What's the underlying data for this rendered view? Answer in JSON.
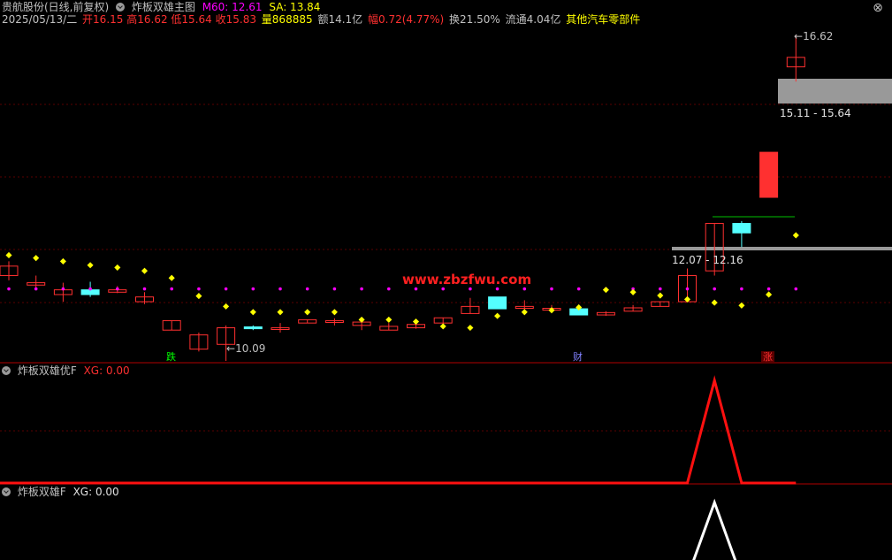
{
  "header": {
    "stock_name": "贵航股份(日线,前复权)",
    "indicator_name": "炸板双雄主图",
    "m60_label": "M60: 12.61",
    "sa_label": "SA: 13.84",
    "date": "2025/05/13/二",
    "open": "开16.15",
    "high": "高16.62",
    "low": "低15.64",
    "close": "收15.83",
    "volume": "量868885",
    "amount": "额14.1亿",
    "change": "幅0.72(4.77%)",
    "turnover": "换21.50%",
    "float": "流通4.04亿",
    "sector": "其他汽车零部件",
    "close_icon": "close-icon",
    "colors": {
      "up": "#ff3030",
      "down": "#54ffff",
      "yellow": "#ffff00",
      "magenta": "#ff00ff"
    }
  },
  "annotations": {
    "high_price": "16.62",
    "low_price": "10.09",
    "range_top": "15.11 - 15.64",
    "range_bottom": "12.07 - 12.16",
    "tag_die": "跌",
    "tag_cai": "财",
    "tag_zhang": "涨"
  },
  "watermark": "www.zbzfwu.com",
  "panel2": {
    "title": "炸板双雄优F",
    "xg": "XG: 0.00"
  },
  "panel3": {
    "title": "炸板双雄F",
    "xg": "XG: 0.00"
  },
  "chart_data": {
    "type": "candlestick",
    "candles": [
      {
        "o": 11.55,
        "c": 11.75,
        "h": 11.85,
        "l": 11.45
      },
      {
        "o": 11.35,
        "c": 11.4,
        "h": 11.55,
        "l": 11.3
      },
      {
        "o": 11.15,
        "c": 11.25,
        "h": 11.4,
        "l": 11.0
      },
      {
        "o": 11.25,
        "c": 11.15,
        "h": 11.42,
        "l": 11.1
      },
      {
        "o": 11.2,
        "c": 11.25,
        "h": 11.33,
        "l": 11.18
      },
      {
        "o": 11.0,
        "c": 11.1,
        "h": 11.2,
        "l": 10.95
      },
      {
        "o": 10.4,
        "c": 10.6,
        "h": 10.6,
        "l": 10.4
      },
      {
        "o": 10.0,
        "c": 10.3,
        "h": 10.35,
        "l": 9.95
      },
      {
        "o": 10.1,
        "c": 10.45,
        "h": 10.5,
        "l": 9.75
      },
      {
        "o": 10.47,
        "c": 10.43,
        "h": 10.5,
        "l": 10.4
      },
      {
        "o": 10.45,
        "c": 10.45,
        "h": 10.55,
        "l": 10.35
      },
      {
        "o": 10.55,
        "c": 10.62,
        "h": 10.62,
        "l": 10.55
      },
      {
        "o": 10.57,
        "c": 10.6,
        "h": 10.65,
        "l": 10.5
      },
      {
        "o": 10.5,
        "c": 10.57,
        "h": 10.6,
        "l": 10.4
      },
      {
        "o": 10.4,
        "c": 10.48,
        "h": 10.55,
        "l": 10.4
      },
      {
        "o": 10.45,
        "c": 10.52,
        "h": 10.6,
        "l": 10.43
      },
      {
        "o": 10.55,
        "c": 10.66,
        "h": 10.66,
        "l": 10.52
      },
      {
        "o": 10.75,
        "c": 10.9,
        "h": 11.08,
        "l": 10.75
      },
      {
        "o": 11.1,
        "c": 10.85,
        "h": 11.1,
        "l": 10.85
      },
      {
        "o": 10.86,
        "c": 10.9,
        "h": 11.03,
        "l": 10.8
      },
      {
        "o": 10.84,
        "c": 10.86,
        "h": 10.93,
        "l": 10.8
      },
      {
        "o": 10.85,
        "c": 10.72,
        "h": 10.85,
        "l": 10.72
      },
      {
        "o": 10.72,
        "c": 10.77,
        "h": 10.8,
        "l": 10.7
      },
      {
        "o": 10.8,
        "c": 10.87,
        "h": 10.93,
        "l": 10.8
      },
      {
        "o": 10.9,
        "c": 11.0,
        "h": 11.0,
        "l": 10.9
      },
      {
        "o": 11.0,
        "c": 11.55,
        "h": 11.7,
        "l": 11.0
      },
      {
        "o": 11.65,
        "c": 12.65,
        "h": 12.65,
        "l": 11.55
      },
      {
        "o": 12.65,
        "c": 12.45,
        "h": 12.7,
        "l": 12.15
      },
      {
        "o": 13.2,
        "c": 14.15,
        "h": 14.15,
        "l": 13.2
      },
      {
        "o": 15.95,
        "c": 16.15,
        "h": 16.62,
        "l": 15.64
      }
    ],
    "dots_magenta": [
      11.27,
      11.27,
      11.27,
      11.27,
      11.27,
      11.27,
      11.27,
      11.27,
      11.27,
      11.27,
      11.27,
      11.27,
      11.27,
      11.27,
      11.27,
      11.27,
      11.27,
      11.27,
      11.27,
      11.27,
      11.27,
      11.27,
      11.27,
      11.27,
      11.27,
      11.27,
      11.27,
      11.27,
      11.27,
      11.27
    ],
    "dots_yellow": [
      11.98,
      11.92,
      11.85,
      11.77,
      11.72,
      11.65,
      11.5,
      11.12,
      10.9,
      10.78,
      10.78,
      10.78,
      10.78,
      10.62,
      10.62,
      10.58,
      10.48,
      10.45,
      10.7,
      10.78,
      10.82,
      10.88,
      11.25,
      11.2,
      11.13,
      11.05,
      10.98,
      10.92,
      11.15,
      12.4
    ],
    "red_line": [
      0,
      0,
      0,
      0,
      0,
      0,
      0,
      0,
      0,
      0,
      0,
      0,
      0,
      0,
      0,
      0,
      0,
      0,
      0,
      0,
      0,
      0,
      0,
      0,
      0,
      0,
      1,
      0,
      0,
      0
    ],
    "white_line": [
      0,
      0,
      0,
      0,
      0,
      0,
      0,
      0,
      0,
      0,
      0,
      0,
      0,
      0,
      0,
      0,
      0,
      0,
      0,
      0,
      0,
      0,
      0,
      0,
      0,
      0,
      1,
      0,
      0,
      0
    ]
  }
}
